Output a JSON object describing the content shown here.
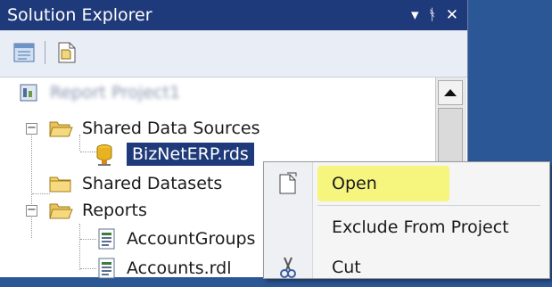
{
  "panel": {
    "title": "Solution Explorer",
    "controls": {
      "dropdown": "▾",
      "pin": "ᚬ",
      "close": "✕"
    }
  },
  "tree": {
    "project": "Report Project1",
    "shared_data_sources": "Shared Data Sources",
    "data_source_file": "BizNetERP.rds",
    "shared_datasets": "Shared Datasets",
    "reports": "Reports",
    "report_items": [
      "AccountGroups",
      "Accounts.rdl"
    ]
  },
  "context_menu": {
    "open": "Open",
    "exclude": "Exclude From Project",
    "cut": "Cut"
  },
  "colors": {
    "title_bg": "#1f3a7a",
    "selection_bg": "#1f3a7a",
    "highlight": "#f6f66a",
    "desktop_bg": "#2b5797"
  }
}
